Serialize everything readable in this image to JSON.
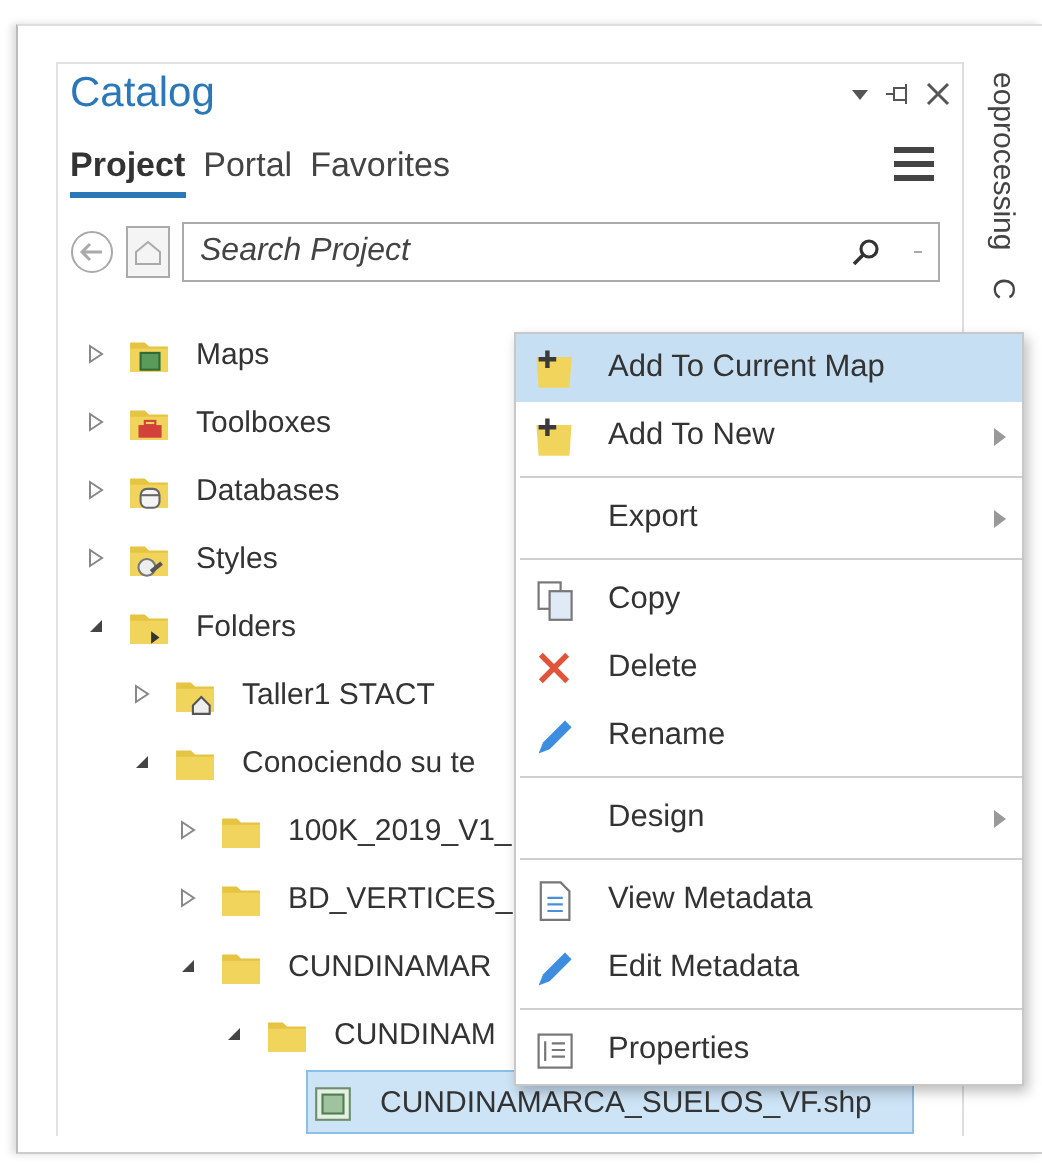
{
  "pane": {
    "title": "Catalog"
  },
  "tabs": [
    {
      "label": "Project",
      "selected": true
    },
    {
      "label": "Portal",
      "selected": false
    },
    {
      "label": "Favorites",
      "selected": false
    }
  ],
  "search": {
    "placeholder": "Search Project"
  },
  "tree": [
    {
      "label": "Maps",
      "kind": "maps",
      "expanded": false,
      "selected": false
    },
    {
      "label": "Toolboxes",
      "kind": "toolboxes",
      "expanded": false,
      "selected": false
    },
    {
      "label": "Databases",
      "kind": "databases",
      "expanded": false,
      "selected": false
    },
    {
      "label": "Styles",
      "kind": "styles",
      "expanded": false,
      "selected": false
    },
    {
      "label": "Folders",
      "kind": "folders",
      "expanded": true,
      "selected": false,
      "children": [
        {
          "label": "Taller1 STACT",
          "kind": "home",
          "expanded": false,
          "selected": false
        },
        {
          "label": "Conociendo su te",
          "kind": "folder",
          "expanded": true,
          "selected": false,
          "children": [
            {
              "label": "100K_2019_V1_",
              "kind": "folder",
              "expanded": false,
              "selected": false
            },
            {
              "label": "BD_VERTICES_",
              "kind": "folder",
              "expanded": false,
              "selected": false
            },
            {
              "label": "CUNDINAMAR",
              "kind": "folder",
              "expanded": true,
              "selected": false,
              "children": [
                {
                  "label": "CUNDINAM",
                  "kind": "folder",
                  "expanded": true,
                  "selected": false,
                  "children": [
                    {
                      "label": "CUNDINAMARCA_SUELOS_VF.shp",
                      "kind": "shapefile",
                      "selected": true
                    }
                  ]
                }
              ]
            }
          ]
        }
      ]
    }
  ],
  "side_strip": {
    "tabs": [
      "eoprocessing",
      "C"
    ]
  },
  "context_menu": [
    {
      "kind": "add",
      "label": "Add To Current Map",
      "highlighted": true,
      "submenu": false
    },
    {
      "kind": "add",
      "label": "Add To New",
      "highlighted": false,
      "submenu": true
    },
    {
      "kind": "separator"
    },
    {
      "kind": "plain",
      "label": "Export",
      "highlighted": false,
      "submenu": true
    },
    {
      "kind": "separator"
    },
    {
      "kind": "copy",
      "label": "Copy",
      "highlighted": false,
      "submenu": false
    },
    {
      "kind": "delete",
      "label": "Delete",
      "highlighted": false,
      "submenu": false
    },
    {
      "kind": "pencil",
      "label": "Rename",
      "highlighted": false,
      "submenu": false
    },
    {
      "kind": "separator"
    },
    {
      "kind": "plain",
      "label": "Design",
      "highlighted": false,
      "submenu": true
    },
    {
      "kind": "separator"
    },
    {
      "kind": "document",
      "label": "View Metadata",
      "highlighted": false,
      "submenu": false
    },
    {
      "kind": "pencil",
      "label": "Edit Metadata",
      "highlighted": false,
      "submenu": false
    },
    {
      "kind": "separator"
    },
    {
      "kind": "properties",
      "label": "Properties",
      "highlighted": false,
      "submenu": false
    }
  ]
}
